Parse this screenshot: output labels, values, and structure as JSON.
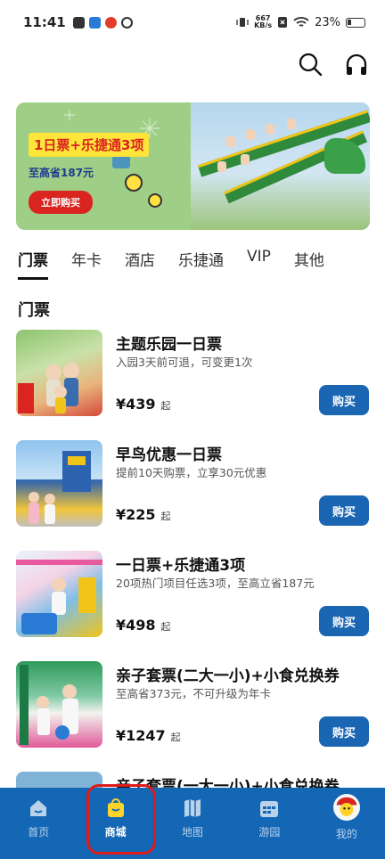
{
  "status_bar": {
    "time": "11:41",
    "net_speed_value": "667",
    "net_speed_unit": "KB/s",
    "battery": "23%"
  },
  "banner": {
    "title": "1日票+乐捷通3项",
    "subtitle": "至高省187元",
    "button": "立即购买"
  },
  "tabs": [
    {
      "label": "门票",
      "active": true
    },
    {
      "label": "年卡",
      "active": false
    },
    {
      "label": "酒店",
      "active": false
    },
    {
      "label": "乐捷通",
      "active": false
    },
    {
      "label": "VIP",
      "active": false
    },
    {
      "label": "其他",
      "active": false
    }
  ],
  "section_title": "门票",
  "products": [
    {
      "name": "主题乐园一日票",
      "desc": "入园3天前可退，可变更1次",
      "price": "¥439",
      "suffix": "起",
      "button": "购买"
    },
    {
      "name": "早鸟优惠一日票",
      "desc": "提前10天购票，立享30元优惠",
      "price": "¥225",
      "suffix": "起",
      "button": "购买"
    },
    {
      "name": "一日票+乐捷通3项",
      "desc": "20项热门项目任选3项，至高立省187元",
      "price": "¥498",
      "suffix": "起",
      "button": "购买"
    },
    {
      "name": "亲子套票(二大一小)+小食兑换券",
      "desc": "至高省373元，不可升级为年卡",
      "price": "¥1247",
      "suffix": "起",
      "button": "购买"
    },
    {
      "name": "亲子套票(一大一小)+小食兑换券",
      "desc": "",
      "price": "",
      "suffix": "",
      "button": ""
    }
  ],
  "bottom_nav": [
    {
      "label": "首页",
      "icon": "home-icon"
    },
    {
      "label": "商城",
      "icon": "shopping-bag-icon",
      "active": true
    },
    {
      "label": "地图",
      "icon": "map-icon"
    },
    {
      "label": "游园",
      "icon": "calendar-icon"
    },
    {
      "label": "我的",
      "icon": "avatar-icon"
    }
  ],
  "colors": {
    "accent": "#1467b5",
    "button": "#1a66b3",
    "highlight_ring": "#e0191a"
  }
}
